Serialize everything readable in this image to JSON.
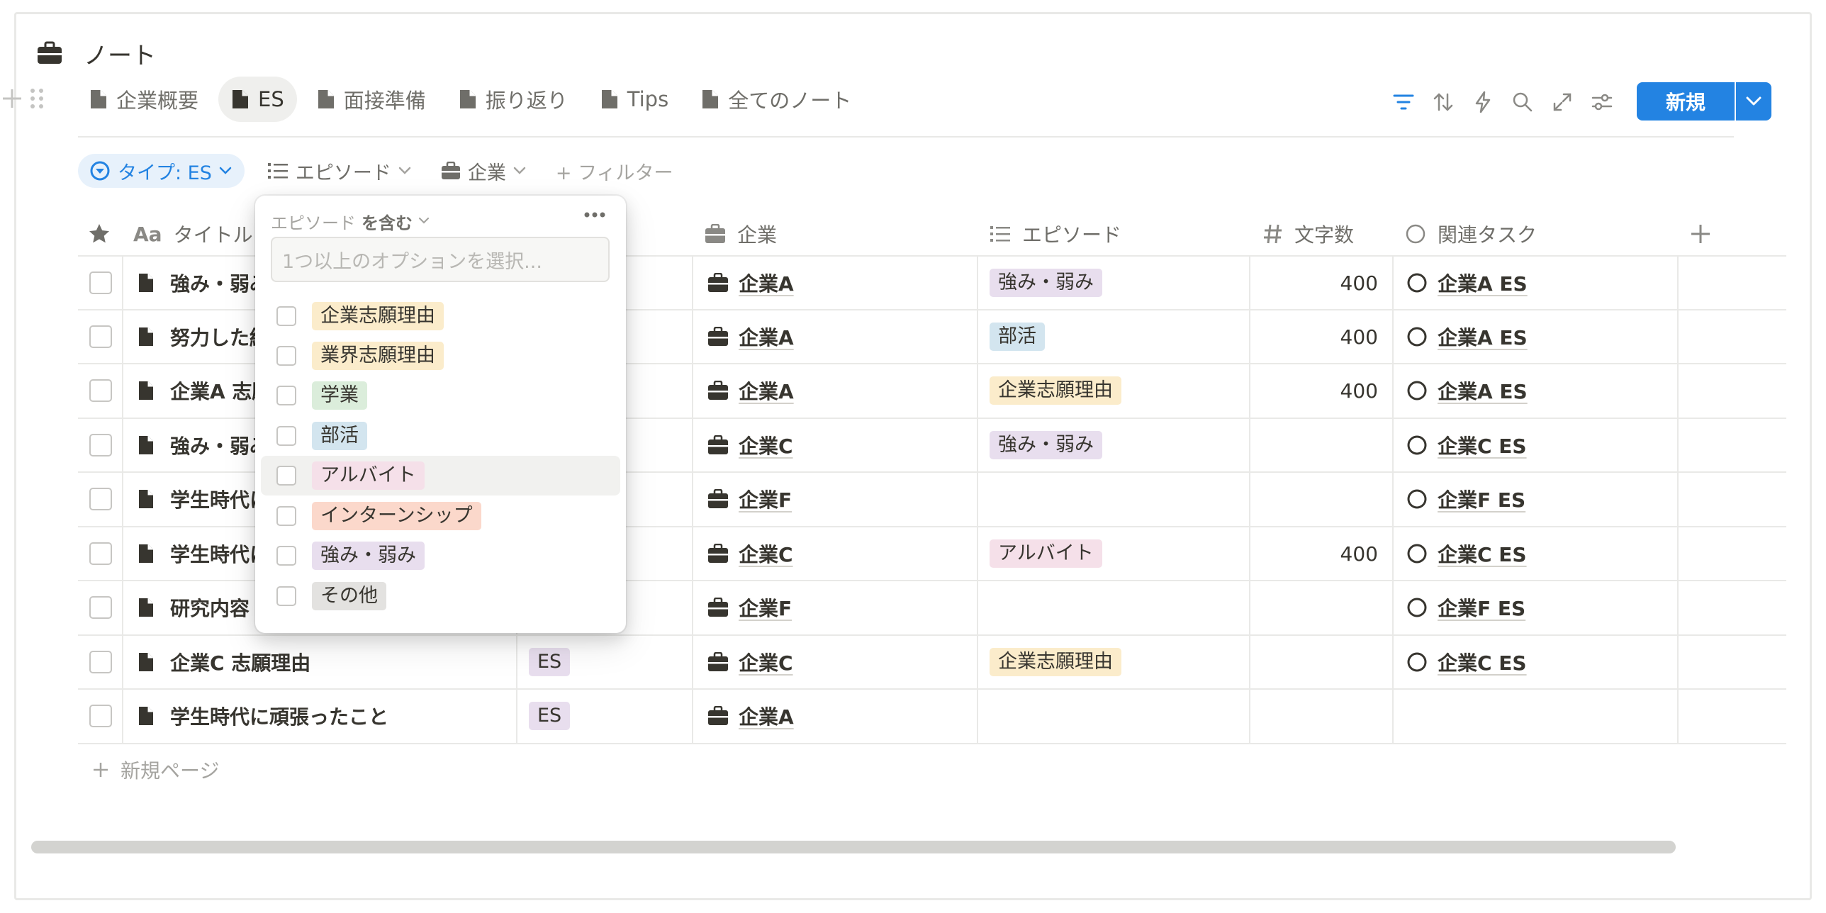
{
  "database": {
    "title": "ノート",
    "icon": "briefcase-icon"
  },
  "tabs": [
    {
      "label": "企業概要",
      "active": false
    },
    {
      "label": "ES",
      "active": true
    },
    {
      "label": "面接準備",
      "active": false
    },
    {
      "label": "振り返り",
      "active": false
    },
    {
      "label": "Tips",
      "active": false
    },
    {
      "label": "全てのノート",
      "active": false
    }
  ],
  "toolbar": {
    "new_label": "新規"
  },
  "filters": {
    "active_chip": "タイプ: ES",
    "episode_chip": "エピソード",
    "company_chip": "企業",
    "add_filter": "+ フィルター"
  },
  "columns": {
    "title": "タイトル",
    "title_icon_text": "Aa",
    "company": "企業",
    "episode": "エピソード",
    "chars": "文字数",
    "task": "関連タスク"
  },
  "rows": [
    {
      "title": "強み・弱み",
      "type": "",
      "company": "企業A",
      "episode": "強み・弱み",
      "episode_color": "purple",
      "chars": "400",
      "task": "企業A ES"
    },
    {
      "title": "努力した経",
      "type": "",
      "company": "企業A",
      "episode": "部活",
      "episode_color": "blue",
      "chars": "400",
      "task": "企業A ES"
    },
    {
      "title": "企業A 志願",
      "type": "",
      "company": "企業A",
      "episode": "企業志願理由",
      "episode_color": "yellow",
      "chars": "400",
      "task": "企業A ES"
    },
    {
      "title": "強み・弱み",
      "type": "",
      "company": "企業C",
      "episode": "強み・弱み",
      "episode_color": "purple",
      "chars": "",
      "task": "企業C ES"
    },
    {
      "title": "学生時代に",
      "type": "",
      "company": "企業F",
      "episode": "",
      "episode_color": "",
      "chars": "",
      "task": "企業F ES"
    },
    {
      "title": "学生時代に",
      "type": "",
      "company": "企業C",
      "episode": "アルバイト",
      "episode_color": "pink",
      "chars": "400",
      "task": "企業C ES"
    },
    {
      "title": "研究内容",
      "type": "",
      "company": "企業F",
      "episode": "",
      "episode_color": "",
      "chars": "",
      "task": "企業F ES"
    },
    {
      "title": "企業C 志願理由",
      "type": "ES",
      "company": "企業C",
      "episode": "企業志願理由",
      "episode_color": "yellow",
      "chars": "",
      "task": "企業C ES"
    },
    {
      "title": "学生時代に頑張ったこと",
      "type": "ES",
      "company": "企業A",
      "episode": "",
      "episode_color": "",
      "chars": "",
      "task": ""
    }
  ],
  "new_page_label": "新規ページ",
  "popup": {
    "property": "エピソード",
    "operator": "を含む",
    "search_placeholder": "1つ以上のオプションを選択...",
    "options": [
      {
        "label": "企業志願理由",
        "color": "yellow"
      },
      {
        "label": "業界志願理由",
        "color": "yellow"
      },
      {
        "label": "学業",
        "color": "green"
      },
      {
        "label": "部活",
        "color": "blue"
      },
      {
        "label": "アルバイト",
        "color": "pink"
      },
      {
        "label": "インターンシップ",
        "color": "salmon"
      },
      {
        "label": "強み・弱み",
        "color": "purple"
      },
      {
        "label": "その他",
        "color": "gray"
      }
    ]
  }
}
